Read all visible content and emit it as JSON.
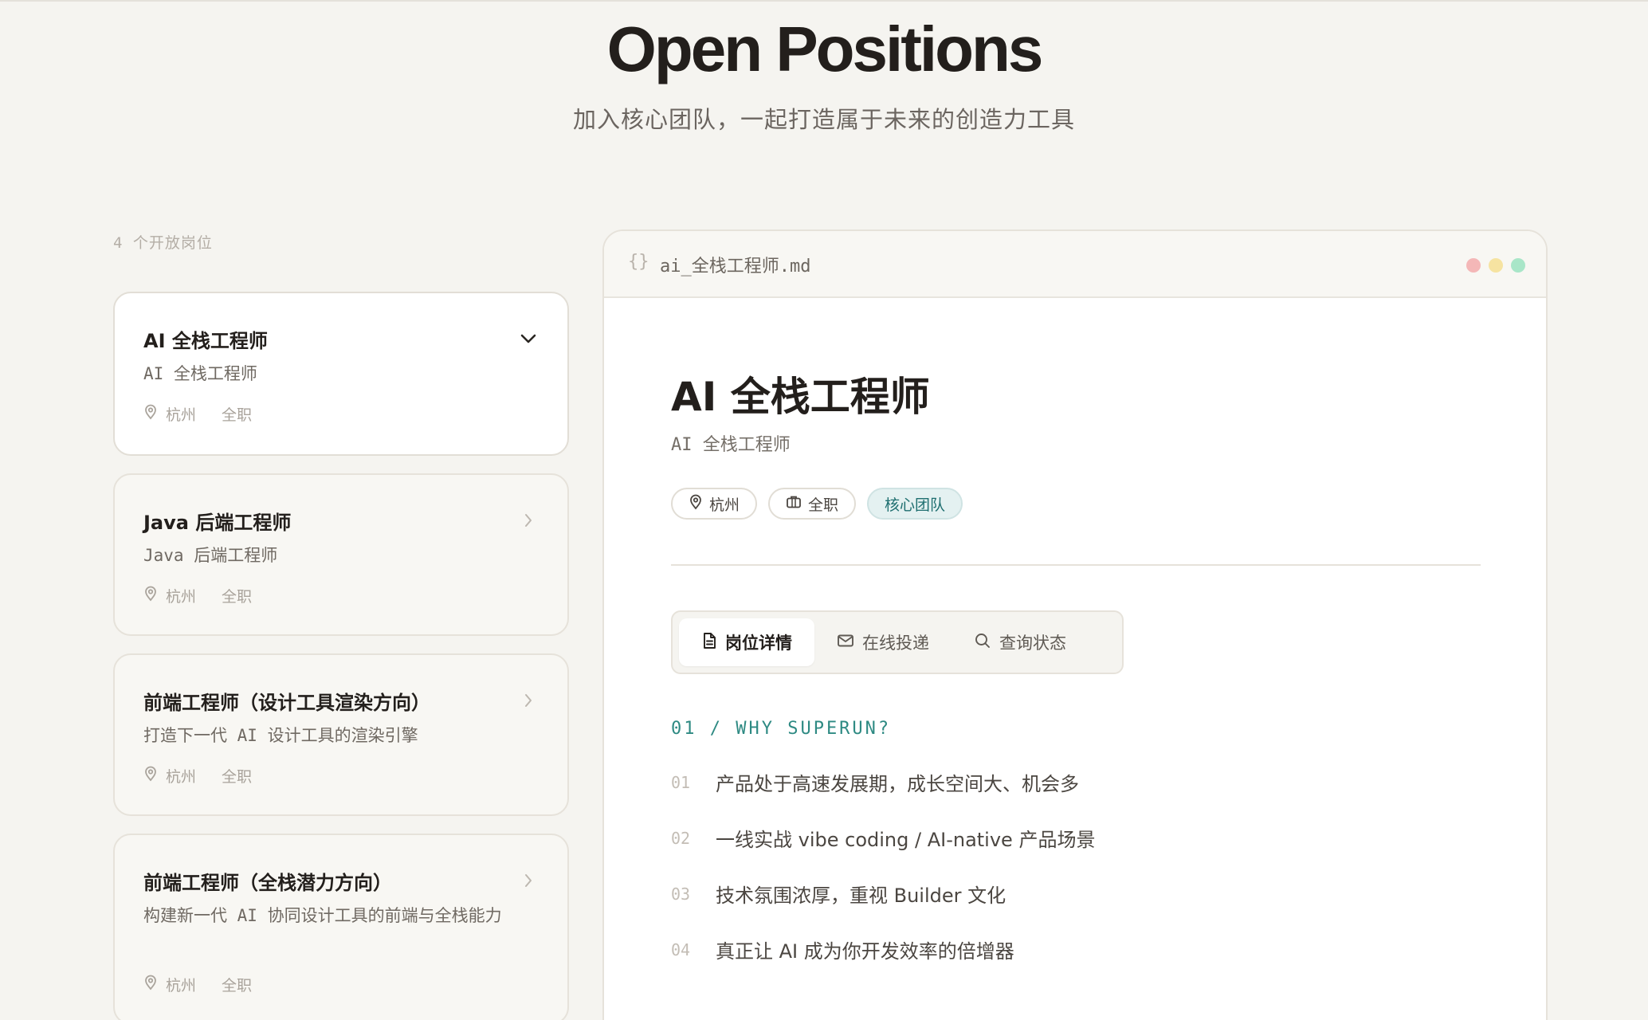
{
  "hero": {
    "title": "Open Positions",
    "subtitle": "加入核心团队，一起打造属于未来的创造力工具"
  },
  "positions": {
    "count_label": "4 个开放岗位",
    "items": [
      {
        "title": "AI 全栈工程师",
        "desc": "AI 全栈工程师",
        "location": "杭州",
        "type": "全职",
        "active": true
      },
      {
        "title": "Java 后端工程师",
        "desc": "Java 后端工程师",
        "location": "杭州",
        "type": "全职",
        "active": false
      },
      {
        "title": "前端工程师（设计工具渲染方向）",
        "desc": "打造下一代 AI 设计工具的渲染引擎",
        "location": "杭州",
        "type": "全职",
        "active": false
      },
      {
        "title": "前端工程师（全栈潜力方向）",
        "desc": "构建新一代 AI 协同设计工具的前端与全栈能力",
        "location": "杭州",
        "type": "全职",
        "active": false
      }
    ]
  },
  "doc": {
    "brace": "{}",
    "filename": "ai_全栈工程师.md",
    "window_dots": [
      "#f4b7b7",
      "#f6e3a1",
      "#a9e6c8"
    ],
    "title": "AI 全栈工程师",
    "subtitle": "AI 全栈工程师",
    "tags": {
      "location": "杭州",
      "type": "全职",
      "team": "核心团队"
    },
    "tabs": [
      {
        "label": "岗位详情",
        "icon": "document-icon",
        "active": true
      },
      {
        "label": "在线投递",
        "icon": "mail-icon",
        "active": false
      },
      {
        "label": "查询状态",
        "icon": "search-icon",
        "active": false
      }
    ],
    "section_heading": "01 / WHY SUPERUN?",
    "reasons": [
      {
        "num": "01",
        "text": "产品处于高速发展期，成长空间大、机会多"
      },
      {
        "num": "02",
        "text": "一线实战 vibe coding / AI-native 产品场景"
      },
      {
        "num": "03",
        "text": "技术氛围浓厚，重视 Builder 文化"
      },
      {
        "num": "04",
        "text": "真正让 AI 成为你开发效率的倍增器"
      }
    ]
  },
  "colors": {
    "accent_teal": "#2e8a83",
    "background": "#f5f4f0",
    "text_dark": "#231f1c"
  }
}
